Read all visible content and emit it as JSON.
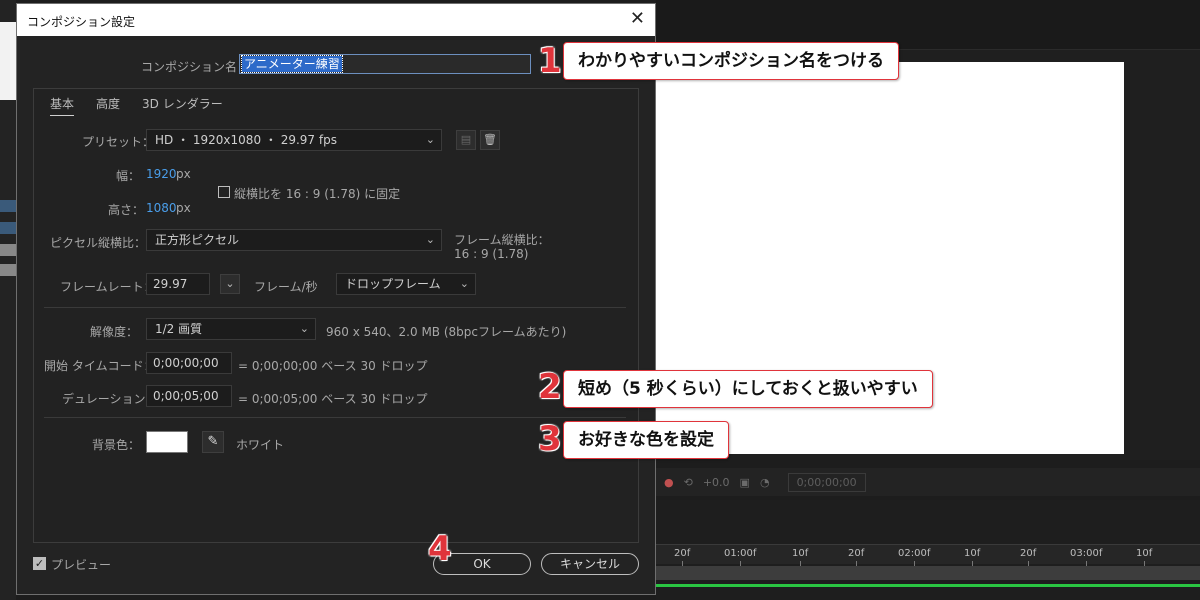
{
  "dialog": {
    "title": "コンポジション設定",
    "close_glyph": "✕",
    "comp_name_label": "コンポジション名：",
    "comp_name_value": "アニメーター練習",
    "tabs": [
      {
        "label": "基本",
        "active": true
      },
      {
        "label": "高度",
        "active": false
      },
      {
        "label": "3D レンダラー",
        "active": false
      }
    ],
    "preset": {
      "label": "プリセット：",
      "value": "HD ・ 1920x1080 ・ 29.97 fps"
    },
    "width": {
      "label": "幅：",
      "value": "1920",
      "unit": "px"
    },
    "height": {
      "label": "高さ：",
      "value": "1080",
      "unit": "px"
    },
    "lock_aspect": {
      "label": "縦横比を 16 : 9 (1.78) に固定",
      "checked": false
    },
    "pixel_aspect": {
      "label": "ピクセル縦横比：",
      "value": "正方形ピクセル"
    },
    "frame_aspect": {
      "label": "フレーム縦横比：",
      "value": "16 : 9 (1.78)"
    },
    "frame_rate": {
      "label": "フレームレート：",
      "value": "29.97",
      "unit": "フレーム/秒",
      "mode": "ドロップフレーム"
    },
    "resolution": {
      "label": "解像度：",
      "value": "1/2 画質",
      "info": "960 x 540、2.0 MB (8bpcフレームあたり)"
    },
    "start_timecode": {
      "label": "開始 タイムコード：",
      "value": "0;00;00;00",
      "info": "= 0;00;00;00  ベース 30   ドロップ"
    },
    "duration": {
      "label": "デュレーション：",
      "value": "0;00;05;00",
      "info": "= 0;00;05;00  ベース 30   ドロップ"
    },
    "bg_color": {
      "label": "背景色：",
      "name": "ホワイト",
      "color": "#ffffff"
    },
    "preview_label": "プレビュー",
    "ok_label": "OK",
    "cancel_label": "キャンセル"
  },
  "viewer": {
    "exposure": "+0.0",
    "timecode": "0;00;00;00"
  },
  "ruler_ticks": [
    "20f",
    "01:00f",
    "10f",
    "20f",
    "02:00f",
    "10f",
    "20f",
    "03:00f",
    "10f"
  ],
  "callouts": [
    {
      "num": "1",
      "text": "わかりやすいコンポジション名をつける"
    },
    {
      "num": "2",
      "text": "短め（5 秒くらい）にしておくと扱いやすい"
    },
    {
      "num": "3",
      "text": "お好きな色を設定"
    },
    {
      "num": "4"
    }
  ],
  "colors": {
    "accent_red": "#e0343b",
    "value_blue": "#4a9eea",
    "timeline_green": "#2ac642"
  }
}
